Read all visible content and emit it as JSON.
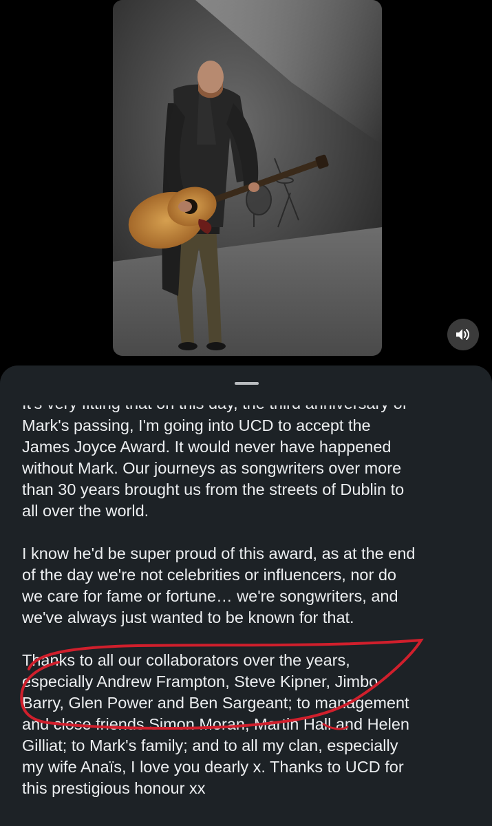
{
  "post": {
    "caption_partial_line": "It's very fitting that on this day, the third anniversary of",
    "paragraph_1": [
      "Mark's passing, I'm going into UCD to accept the",
      "James Joyce Award. It would never have happened",
      "without Mark. Our journeys as songwriters over more",
      "than 30 years brought us from the streets of Dublin to",
      "all over the world."
    ],
    "paragraph_2": [
      "I know he'd be super proud of this award, as at the end",
      "of the day we're not celebrities or influencers, nor do",
      "we care for fame or fortune… we're songwriters, and",
      "we've always just wanted to be known for that."
    ],
    "paragraph_3": [
      "Thanks to all our collaborators over the years,",
      "especially Andrew Frampton, Steve Kipner, Jimbo",
      "Barry, Glen Power and Ben Sargeant; to management",
      "and close friends Simon Moran, Martin Hall and Helen",
      "Gilliat; to Mark's family; and to all my clan, especially",
      "my wife Anaïs, I love you dearly x. Thanks to UCD for",
      "this prestigious honour xx"
    ]
  },
  "video": {
    "mute_icon": "speaker-icon"
  },
  "colors": {
    "background": "#000000",
    "sheet": "#1d2226",
    "text": "#eceef0",
    "annotation": "#d01f2c"
  }
}
